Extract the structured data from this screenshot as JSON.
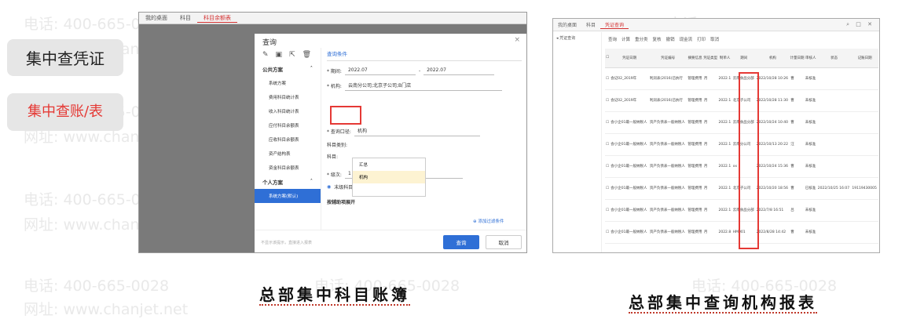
{
  "watermark": {
    "phone": "电话: 400-665-0028",
    "site": "网址: www.chanjet.net"
  },
  "left_panel": {
    "item1": "集中查凭证",
    "item2": "集中查账/表"
  },
  "captions": {
    "left": "总部集中科目账簿",
    "right": "总部集中查询机构报表"
  },
  "shot1": {
    "tabs": [
      "我的桌面",
      "科目",
      "科目余额表"
    ],
    "dialog_title": "查询",
    "close": "×",
    "public_scheme": "公共方案",
    "schemes": [
      "系统方案",
      "费用科目统计表",
      "收入科目统计表",
      "应付科目余额表",
      "应收科目余额表",
      "资产结构表",
      "资金科目余额表"
    ],
    "personal_scheme": "个人方案",
    "personal_items": [
      "系统方案(默认)"
    ],
    "cond_title": "查询条件",
    "period_label": "* 期间:",
    "period_from": "2022.07",
    "period_to": "2022.07",
    "org_label": "* 机构:",
    "org_value": "云南分公司;北京子公司;B门店",
    "query_caliber_label": "* 查询口径:",
    "query_caliber_value": "机构",
    "subject_type_label": "科目类别:",
    "subject_label": "科目:",
    "dropdown_options": [
      "汇总",
      "机构"
    ],
    "level_label": "* 级次:",
    "level_from": "1",
    "level_to": "1",
    "leaf_label": "末级科目",
    "aux_label": "按辅助项展开",
    "add_filter": "添加过滤条件",
    "footer_note": "不显示该提示，直接进入报表",
    "btn_query": "查询",
    "btn_cancel": "取消"
  },
  "shot2": {
    "tabs": [
      "我的桌面",
      "科目",
      "凭证查询"
    ],
    "side_title": "凭证查询",
    "tools": [
      "查询",
      "计算",
      "重分类",
      "复核",
      "撤销",
      "现金流",
      "打印",
      "取消"
    ],
    "headers": [
      "",
      "凭证日期",
      "凭证编号",
      "摘要信息",
      "凭证类型",
      "制单人",
      "期间",
      "机构",
      "日结",
      "计量日期",
      "审核人",
      "状态",
      "记账日期",
      "记账人"
    ],
    "rows": [
      [
        "",
        "会记02_2019年",
        "利润表(2016)已执行",
        "管理费用",
        "月",
        "2022.1",
        "云南食品分部",
        "2022/10/28 10:26",
        "曹",
        "未核准",
        "",
        ""
      ],
      [
        "",
        "会记02_2019年",
        "利润表(2016)已执行",
        "管理费用",
        "月",
        "2022.1",
        "北京子公司",
        "2022/10/28 11:30",
        "曹",
        "未核准",
        "",
        ""
      ],
      [
        "",
        "会小企01最一般纳税人",
        "资产负债表一般纳税人",
        "管理费用",
        "月",
        "2022.1",
        "云南食品分部",
        "2022/10/24 10:40",
        "曹",
        "未核准",
        "",
        ""
      ],
      [
        "",
        "会小企01最一般纳税人",
        "资产负债表一般纳税人",
        "管理费用",
        "月",
        "2022.1",
        "云南分公司",
        "2022/10/13 20:22",
        "汪",
        "未核准",
        "",
        ""
      ],
      [
        "",
        "会小企01最一般纳税人",
        "资产负债表一般纳税人",
        "管理费用",
        "月",
        "2022.1",
        "xx",
        "2022/10/24 15:36",
        "曹",
        "未核准",
        "",
        ""
      ],
      [
        "",
        "会小企01最一般纳税人",
        "资产负债表一般纳税人",
        "管理费用",
        "月",
        "2022.1",
        "北京子公司",
        "2022/10/20 18:56",
        "曹",
        "已核准",
        "2022/10/25 16:07",
        "19119430005"
      ],
      [
        "",
        "会小企01最一般纳税人",
        "资产负债表一般纳税人",
        "管理费用",
        "月",
        "2022.1",
        "云南食品分部",
        "2022/7/8 16:51",
        "吕",
        "未核准",
        "",
        ""
      ],
      [
        "",
        "会小企01最一般纳税人",
        "资产负债表一般纳税人",
        "管理费用",
        "月",
        "2022.8",
        "HM001",
        "2022/8/28 14:42",
        "曹",
        "未核准",
        "",
        ""
      ]
    ]
  }
}
